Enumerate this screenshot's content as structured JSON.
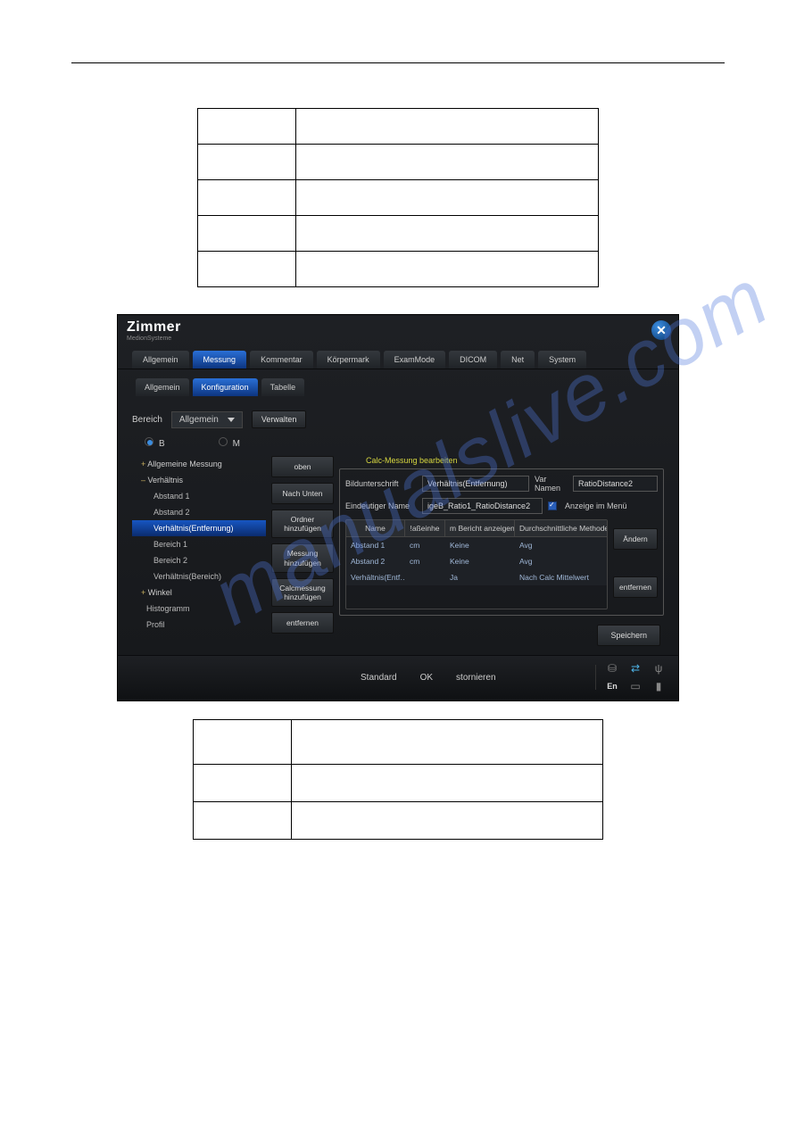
{
  "app": {
    "brand_name": "Zimmer",
    "brand_sub": "MedionSysteme",
    "title_obscured": "",
    "close_symbol": "✕",
    "main_tabs": [
      "Allgemein",
      "Messung",
      "Kommentar",
      "Körpermark",
      "ExamMode",
      "DICOM",
      "Net",
      "System"
    ],
    "main_tab_active": 1,
    "sub_tabs": [
      "Allgemein",
      "Konfiguration",
      "Tabelle"
    ],
    "sub_tab_active": 1,
    "section_label": "Bereich",
    "section_value": "Allgemein",
    "manage_btn": "Verwalten",
    "radios": {
      "b": "B",
      "m": "M",
      "selected": "b"
    },
    "tree": {
      "allg": "Allgemeine Messung",
      "verh": "Verhältnis",
      "children": [
        "Abstand 1",
        "Abstand 2",
        "Verhältnis(Entfernung)",
        "Bereich 1",
        "Bereich 2",
        "Verhältnis(Bereich)"
      ],
      "selected_index": 2,
      "winkel": "Winkel",
      "hist": "Histogramm",
      "profil": "Profil"
    },
    "mid_buttons": [
      "oben",
      "Nach Unten",
      "Ordner hinzufügen",
      "Messung hinzufügen",
      "Calcmessung hinzufügen",
      "entfernen"
    ],
    "editor": {
      "title": "Calc-Messung bearbeiten",
      "caption_label": "Bildunterschrift",
      "caption_value": "Verhältnis(Entfernung)",
      "varname_label": "Var Namen",
      "varname_value": "RatioDistance2",
      "unique_label": "Eindeutiger Name",
      "unique_value": "igeB_Ratio1_RatioDistance2",
      "menu_check": "Anzeige im Menü",
      "table_head": [
        "Name",
        "!aßeinhe",
        "m Bericht anzeigen",
        "Durchschnittliche Methode"
      ],
      "rows": [
        {
          "name": "Abstand 1",
          "unit": "cm",
          "show": "Keine",
          "method": "Avg"
        },
        {
          "name": "Abstand 2",
          "unit": "cm",
          "show": "Keine",
          "method": "Avg"
        },
        {
          "name": "Verhältnis(Entf…",
          "unit": "",
          "show": "Ja",
          "method": "Nach Calc Mittelwert"
        }
      ],
      "change_btn": "Ändern",
      "remove_btn": "entfernen",
      "save_btn": "Speichern"
    },
    "footer": {
      "standard": "Standard",
      "ok": "OK",
      "cancel": "stornieren",
      "lang": "En"
    }
  }
}
